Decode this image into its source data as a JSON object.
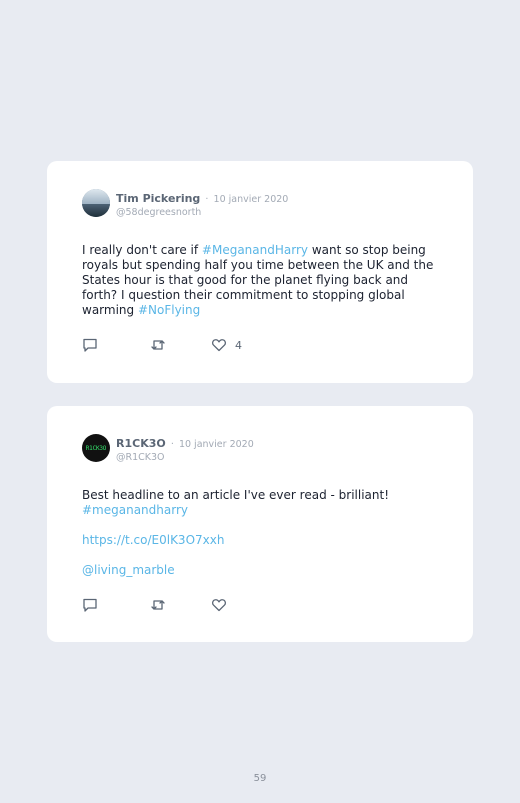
{
  "tweets": [
    {
      "display_name": "Tim Pickering",
      "date": "10 janvier 2020",
      "handle": "@58degreesnorth",
      "body": {
        "t1": "I really don't care if ",
        "hashtag1": "#MeganandHarry",
        "t2": " want so stop being royals but spending half you time between the UK and the States hour is that good for the planet flying back and forth? I question their commitment to stopping global warming ",
        "hashtag2": "#NoFlying"
      },
      "like_count": "4",
      "icons": {
        "reply": "reply-icon",
        "retweet": "retweet-icon",
        "like": "heart-icon"
      }
    },
    {
      "display_name": "R1CK3O",
      "date": "10 janvier 2020",
      "handle": "@R1CK3O",
      "avatar_text": "R1CK3O",
      "body": {
        "t1": "Best headline to an article I've ever read - brilliant!",
        "hashtag1": "#meganandharry",
        "url": "https://t.co/E0lK3O7xxh",
        "mention": "@living_marble"
      },
      "icons": {
        "reply": "reply-icon",
        "retweet": "retweet-icon",
        "like": "heart-icon"
      }
    }
  ],
  "separator": "·",
  "page_number": "59",
  "colors": {
    "background": "#e8ebf2",
    "card": "#ffffff",
    "link": "#5ab6e6",
    "muted": "#a3aab5",
    "name": "#5b6675"
  }
}
